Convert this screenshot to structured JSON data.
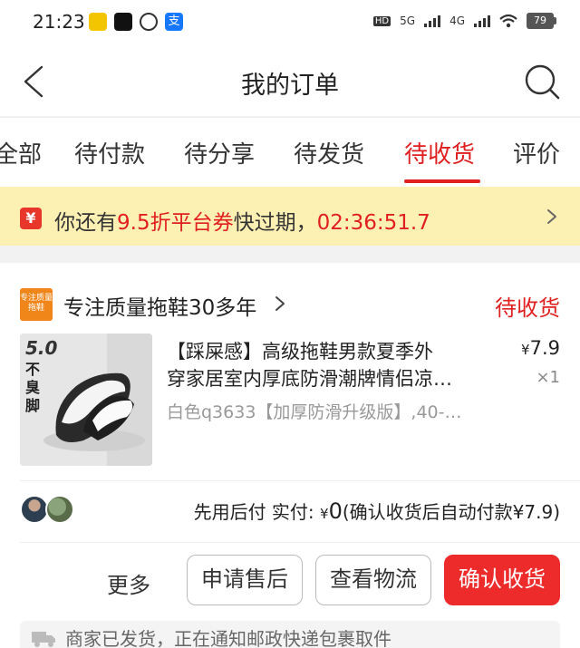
{
  "status_bar": {
    "time": "21:23",
    "network_labels": [
      "HD",
      "5G",
      "4G"
    ],
    "battery": "79"
  },
  "nav": {
    "title": "我的订单",
    "back_icon": "chevron-left-icon",
    "search_icon": "search-icon"
  },
  "tabs": [
    {
      "label": "全部",
      "active": false
    },
    {
      "label": "待付款",
      "active": false
    },
    {
      "label": "待分享",
      "active": false
    },
    {
      "label": "待发货",
      "active": false
    },
    {
      "label": "待收货",
      "active": true
    },
    {
      "label": "评价",
      "active": false
    }
  ],
  "coupon": {
    "icon_text": "¥",
    "prefix": "你还有",
    "highlight": "9.5折平台券",
    "suffix": "快过期，",
    "countdown": "02:36:51.7"
  },
  "order": {
    "shop_logo_text": "专注质量拖鞋",
    "shop_name": "专注质量拖鞋30多年",
    "status": "待收货",
    "product": {
      "title_line1": "【踩屎感】高级拖鞋男款夏季外",
      "title_line2": "穿家居室内厚底防滑潮牌情侣凉…",
      "sku": "白色q3633【加厚防滑升级版】,40-…",
      "price_symbol": "¥",
      "price": "7.9",
      "quantity": "×1",
      "image_text_big": "5.0",
      "image_text_side": "不臭脚"
    },
    "payment": {
      "label": "先用后付 实付: ",
      "currency": "¥",
      "paid": "0",
      "note": "(确认收货后自动付款¥7.9)"
    },
    "actions": {
      "more": "更多",
      "after_sale": "申请售后",
      "logistics": "查看物流",
      "confirm": "确认收货"
    },
    "logistics_text": "商家已发货，正在通知邮政快递包裹取件"
  },
  "colors": {
    "accent": "#e02020",
    "coupon_bg": "#fdf0b3",
    "button_primary": "#ee2b2b"
  }
}
